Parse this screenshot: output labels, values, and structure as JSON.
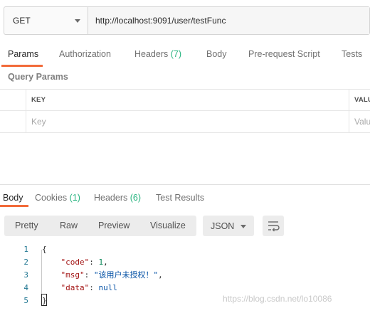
{
  "request": {
    "method": "GET",
    "url": "http://localhost:9091/user/testFunc"
  },
  "request_tabs": [
    {
      "label": "Params",
      "count": ""
    },
    {
      "label": "Authorization",
      "count": ""
    },
    {
      "label": "Headers",
      "count": "(7)"
    },
    {
      "label": "Body",
      "count": ""
    },
    {
      "label": "Pre-request Script",
      "count": ""
    },
    {
      "label": "Tests",
      "count": ""
    }
  ],
  "query_params": {
    "title": "Query Params",
    "columns": [
      "KEY",
      "VALUE"
    ],
    "key_placeholder": "Key",
    "value_placeholder": "Value"
  },
  "response_tabs": [
    {
      "label": "Body",
      "count": ""
    },
    {
      "label": "Cookies",
      "count": "(1)"
    },
    {
      "label": "Headers",
      "count": "(6)"
    },
    {
      "label": "Test Results",
      "count": ""
    }
  ],
  "response_toolbar": {
    "views": [
      "Pretty",
      "Raw",
      "Preview",
      "Visualize"
    ],
    "format": "JSON"
  },
  "response_code": {
    "line_numbers": [
      "1",
      "2",
      "3",
      "4",
      "5"
    ],
    "open_brace": "{",
    "close_brace": "}",
    "code_key": "\"code\"",
    "code_value": "1",
    "msg_key": "\"msg\"",
    "msg_value": "\"该用户未授权！\"",
    "data_key": "\"data\"",
    "data_value": "null"
  },
  "watermark": "https://blog.csdn.net/lo10086"
}
